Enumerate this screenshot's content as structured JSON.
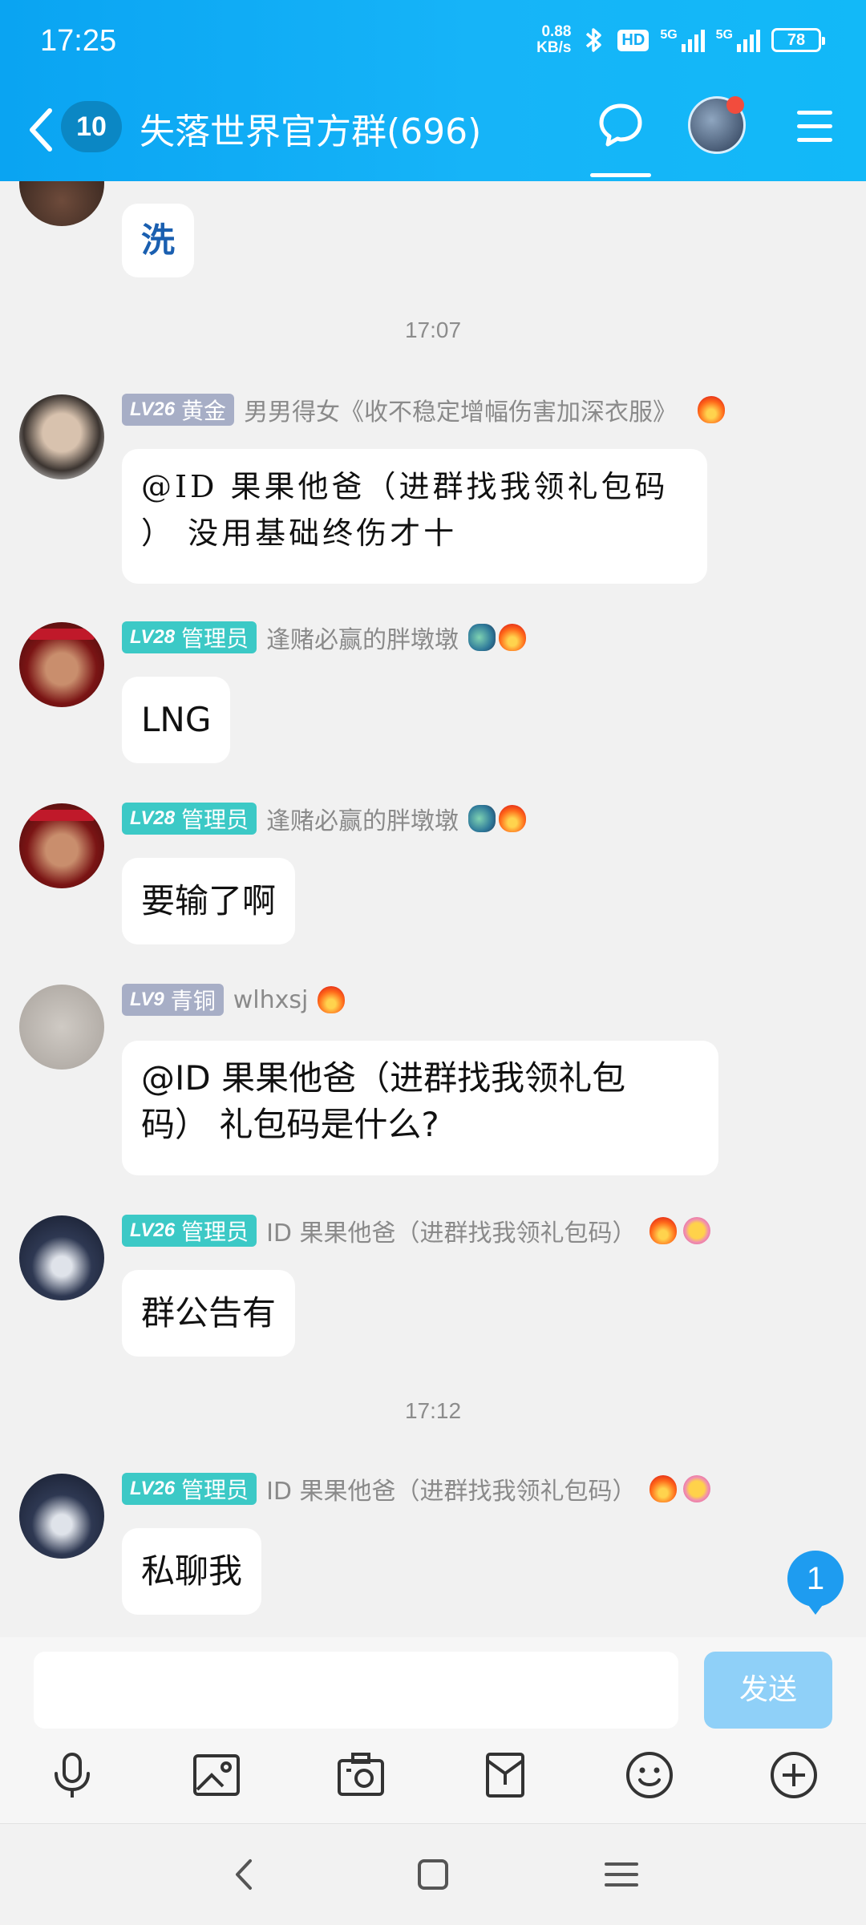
{
  "status_bar": {
    "time": "17:25",
    "net_speed_value": "0.88",
    "net_speed_unit": "KB/s",
    "hd": "HD",
    "sim1": "5G",
    "sim2": "5G",
    "battery": "78"
  },
  "header": {
    "unread_count": "10",
    "title": "失落世界官方群(696)"
  },
  "messages": [
    {
      "bubble": "洗"
    },
    {
      "time": "17:07"
    },
    {
      "level": "LV26",
      "title": "黄金",
      "nickname": "男男得女《收不稳定增幅伤害加深衣服》",
      "bubble": "@ID 果果他爸（进群找我领礼包码 ） 没用基础终伤才十"
    },
    {
      "level": "LV28",
      "title": "管理员",
      "nickname": "逢赌必赢的胖墩墩",
      "bubble": "LNG"
    },
    {
      "level": "LV28",
      "title": "管理员",
      "nickname": "逢赌必赢的胖墩墩",
      "bubble": "要输了啊"
    },
    {
      "level": "LV9",
      "title": "青铜",
      "nickname": "wlhxsj",
      "bubble_line1": "@ID 果果他爸（进群找我领礼包",
      "bubble_line2": "码） 礼包码是什么?"
    },
    {
      "level": "LV26",
      "title": "管理员",
      "nickname": "ID 果果他爸（进群找我领礼包码）",
      "bubble": "群公告有"
    },
    {
      "time": "17:12"
    },
    {
      "level": "LV26",
      "title": "管理员",
      "nickname": "ID 果果他爸（进群找我领礼包码）",
      "bubble": "私聊我"
    }
  ],
  "new_message_count": "1",
  "composer": {
    "input_value": "",
    "send_label": "发送"
  },
  "toolbar_icons": [
    "microphone-icon",
    "image-icon",
    "camera-icon",
    "red-packet-icon",
    "emoji-icon",
    "plus-icon"
  ],
  "icons": {
    "fire": "fire-icon",
    "dragon": "dragon-icon",
    "smile": "smile-badge-icon"
  },
  "colors": {
    "header": "#12b0f6",
    "admin_badge": "#3cc9c6",
    "level_badge": "#a7aec6",
    "send_disabled": "#8fd0f8"
  }
}
